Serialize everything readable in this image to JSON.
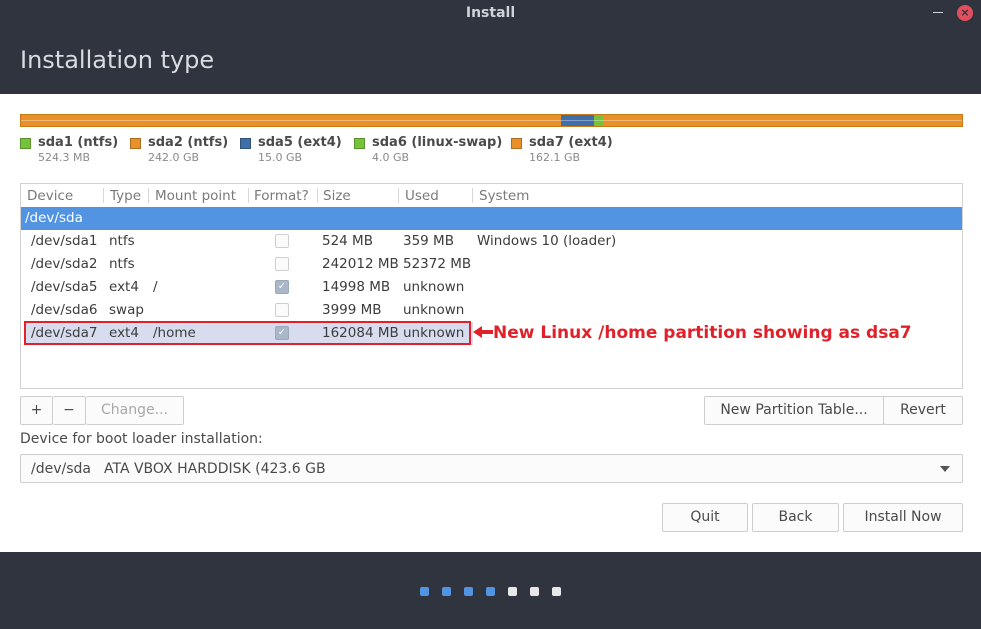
{
  "window": {
    "title": "Install"
  },
  "header": {
    "title": "Installation type"
  },
  "colors": {
    "ntfs": "#77c23a",
    "ntfs2": "#e8912a",
    "ext4_root": "#3f6ea8",
    "swap": "#77c23a",
    "ext4_home": "#e8912a",
    "selection": "#5294e2",
    "annotation": "#e0212a"
  },
  "legend": [
    {
      "name": "sda1 (ntfs)",
      "size": "524.3 MB",
      "color": "#77c23a"
    },
    {
      "name": "sda2 (ntfs)",
      "size": "242.0 GB",
      "color": "#e8912a"
    },
    {
      "name": "sda5 (ext4)",
      "size": "15.0 GB",
      "color": "#3f6ea8"
    },
    {
      "name": "sda6 (linux-swap)",
      "size": "4.0 GB",
      "color": "#77c23a"
    },
    {
      "name": "sda7 (ext4)",
      "size": "162.1 GB",
      "color": "#e8912a"
    }
  ],
  "table": {
    "columns": [
      "Device",
      "Type",
      "Mount point",
      "Format?",
      "Size",
      "Used",
      "System"
    ],
    "disk": "/dev/sda",
    "rows": [
      {
        "device": "/dev/sda1",
        "type": "ntfs",
        "mount": "",
        "format": false,
        "size": "524 MB",
        "used": "359 MB",
        "system": "Windows 10 (loader)"
      },
      {
        "device": "/dev/sda2",
        "type": "ntfs",
        "mount": "",
        "format": false,
        "size": "242012 MB",
        "used": "52372 MB",
        "system": ""
      },
      {
        "device": "/dev/sda5",
        "type": "ext4",
        "mount": "/",
        "format": true,
        "size": "14998 MB",
        "used": "unknown",
        "system": ""
      },
      {
        "device": "/dev/sda6",
        "type": "swap",
        "mount": "",
        "format": false,
        "size": "3999 MB",
        "used": "unknown",
        "system": ""
      },
      {
        "device": "/dev/sda7",
        "type": "ext4",
        "mount": "/home",
        "format": true,
        "size": "162084 MB",
        "used": "unknown",
        "system": ""
      }
    ]
  },
  "annotation": {
    "text": "New Linux /home partition showing as dsa7"
  },
  "toolbar": {
    "add": "+",
    "remove": "−",
    "change": "Change...",
    "new_table": "New Partition Table...",
    "revert": "Revert"
  },
  "bootloader": {
    "label": "Device for boot loader installation:",
    "device": "/dev/sda",
    "description": "ATA VBOX HARDDISK (423.6 GB"
  },
  "actions": {
    "quit": "Quit",
    "back": "Back",
    "install": "Install Now"
  },
  "progress": {
    "total": 7,
    "completed": 4,
    "active_color": "#5294e2",
    "inactive_color": "#e8e8e8"
  }
}
